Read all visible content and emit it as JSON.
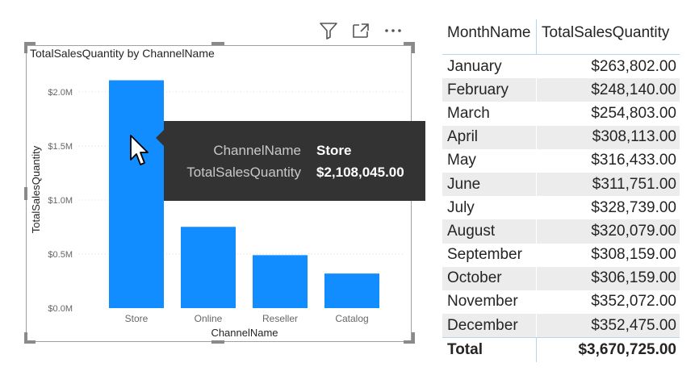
{
  "visual_header": {
    "icons": [
      "filter-icon",
      "focus-mode-icon",
      "more-options-icon"
    ]
  },
  "chart": {
    "title": "TotalSalesQuantity by ChannelName",
    "bar_color": "#118dff"
  },
  "chart_data": {
    "type": "bar",
    "title": "TotalSalesQuantity by ChannelName",
    "xlabel": "ChannelName",
    "ylabel": "TotalSalesQuantity",
    "categories": [
      "Store",
      "Online",
      "Reseller",
      "Catalog"
    ],
    "values": [
      2108045,
      752000,
      490000,
      320000
    ],
    "ylim": [
      0,
      2000000
    ],
    "yticks": [
      0,
      500000,
      1000000,
      1500000,
      2000000
    ],
    "ytick_labels": [
      "$0.0M",
      "$0.5M",
      "$1.0M",
      "$1.5M",
      "$2.0M"
    ],
    "grid": true,
    "legend": "none"
  },
  "tooltip": {
    "key1": "ChannelName",
    "val1": "Store",
    "key2": "TotalSalesQuantity",
    "val2": "$2,108,045.00"
  },
  "table": {
    "headers": [
      "MonthName",
      "TotalSalesQuantity"
    ],
    "rows": [
      {
        "month": "January",
        "value": "$263,802.00"
      },
      {
        "month": "February",
        "value": "$248,140.00"
      },
      {
        "month": "March",
        "value": "$254,803.00"
      },
      {
        "month": "April",
        "value": "$308,113.00"
      },
      {
        "month": "May",
        "value": "$316,433.00"
      },
      {
        "month": "June",
        "value": "$311,751.00"
      },
      {
        "month": "July",
        "value": "$328,739.00"
      },
      {
        "month": "August",
        "value": "$320,079.00"
      },
      {
        "month": "September",
        "value": "$308,159.00"
      },
      {
        "month": "October",
        "value": "$306,159.00"
      },
      {
        "month": "November",
        "value": "$352,072.00"
      },
      {
        "month": "December",
        "value": "$352,475.00"
      }
    ],
    "total_label": "Total",
    "total_value": "$3,670,725.00"
  }
}
